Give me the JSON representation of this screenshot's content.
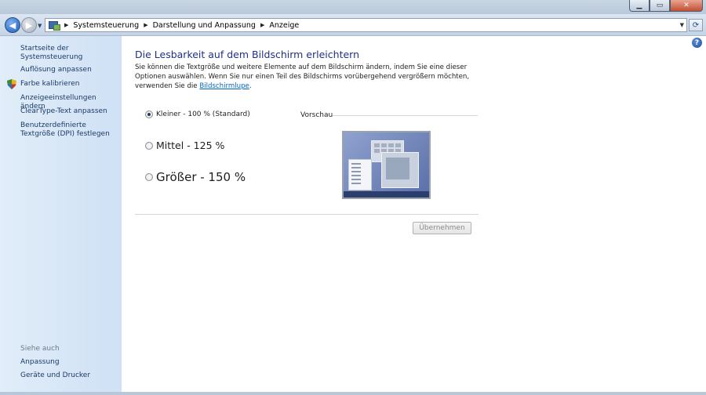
{
  "window": {
    "minimize_glyph": "▁",
    "maximize_glyph": "▭",
    "close_glyph": "✕"
  },
  "nav": {
    "back_glyph": "◀",
    "forward_glyph": "▶",
    "dropdown_glyph": "▼",
    "breadcrumbs": [
      "Systemsteuerung",
      "Darstellung und Anpassung",
      "Anzeige"
    ],
    "refresh_glyph": "⟳"
  },
  "sidebar": {
    "items": [
      {
        "label": "Startseite der Systemsteuerung"
      },
      {
        "label": "Auflösung anpassen"
      },
      {
        "label": "Farbe kalibrieren",
        "icon": "shield-icon"
      },
      {
        "label": "Anzeigeeinstellungen ändern"
      },
      {
        "label": "ClearType-Text anpassen"
      },
      {
        "label": "Benutzerdefinierte Textgröße (DPI) festlegen"
      }
    ],
    "see_also": "Siehe auch",
    "see_also_items": [
      "Anpassung",
      "Geräte und Drucker"
    ]
  },
  "main": {
    "title": "Die Lesbarkeit auf dem Bildschirm erleichtern",
    "description": "Sie können die Textgröße und weitere Elemente auf dem Bildschirm ändern, indem Sie eine dieser Optionen auswählen. Wenn Sie nur einen Teil des Bildschirms vorübergehend vergrößern möchten, verwenden Sie die",
    "description_link": "Bildschirmlupe",
    "description_end": ".",
    "options": [
      {
        "label": "Kleiner - 100 % (Standard)",
        "checked": true
      },
      {
        "label": "Mittel - 125 %",
        "checked": false
      },
      {
        "label": "Größer - 150 %",
        "checked": false
      }
    ],
    "preview_label": "Vorschau",
    "apply_button": "Übernehmen"
  },
  "help_glyph": "?",
  "colors": {
    "heading": "#1e3287",
    "link": "#0066cc",
    "sidebar_bg": "#d9e8f7"
  }
}
